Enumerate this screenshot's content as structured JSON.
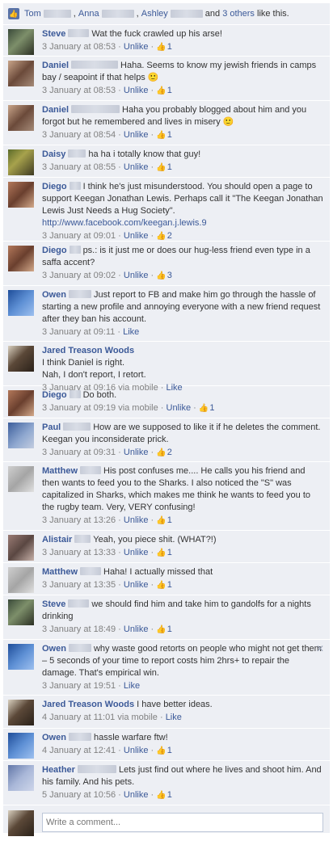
{
  "likes": {
    "names": [
      "Tom",
      "Anna",
      "Ashley"
    ],
    "and_text": "and",
    "others_link": "3 others",
    "suffix": "like this.",
    "thumb": "👍"
  },
  "labels": {
    "unlike": "Unlike",
    "like": "Like",
    "sep": " · "
  },
  "comments": [
    {
      "name": "Steve",
      "blur": 26,
      "text": "Wat the fuck crawled up his arse!",
      "time": "3 January at 08:53",
      "mobile": false,
      "action": "Unlike",
      "likes": "1",
      "avatar": "steve",
      "h": 39
    },
    {
      "name": "Daniel",
      "blur": 58,
      "text": "Haha. Seems to know my jewish friends in camps bay / seapoint if that helps 🙂",
      "time": "3 January at 08:53",
      "mobile": false,
      "action": "Unlike",
      "likes": "1",
      "avatar": "daniel",
      "h": 55
    },
    {
      "name": "Daniel",
      "blur": 60,
      "text": "Haha you probably blogged about him and you forgot but he remembered and lives in misery 🙂",
      "time": "3 January at 08:54",
      "mobile": false,
      "action": "Unlike",
      "likes": "1",
      "avatar": "daniel",
      "h": 55
    },
    {
      "name": "Daisy",
      "blur": 22,
      "text": "ha ha i totally know that guy!",
      "time": "3 January at 08:55",
      "mobile": false,
      "action": "Unlike",
      "likes": "1",
      "avatar": "daisy",
      "h": 40
    },
    {
      "name": "Diego",
      "blur": 14,
      "text": "I think he's just misunderstood. You should open a page to support Keegan Jonathan Lewis. Perhaps call it \"The Keegan Jonathan Lewis Just Needs a Hug Society\".",
      "link": "http://www.facebook.com/keegan.j.lewis.9",
      "time": "3 January at 09:01",
      "mobile": false,
      "action": "Unlike",
      "likes": "2",
      "avatar": "diego",
      "h": 79
    },
    {
      "name": "Diego",
      "blur": 14,
      "text": "ps.: is it just me or does our hug-less friend even type in a saffa accent?",
      "time": "3 January at 09:02",
      "mobile": false,
      "action": "Unlike",
      "likes": "3",
      "avatar": "diego",
      "h": 55
    },
    {
      "name": "Owen",
      "blur": 28,
      "text": "Just report to FB and make him go through the hassle of starting a new profile and annoying everyone with a new friend request after they ban his account.",
      "time": "3 January at 09:11",
      "mobile": false,
      "action": "Like",
      "likes": "",
      "avatar": "owen",
      "h": 69
    },
    {
      "name": "Jared Treason Woods",
      "blur": 0,
      "text": "I think Daniel is right.\nNah, I don't report, I retort.",
      "time": "3 January at 09:16",
      "mobile": true,
      "action": "Like",
      "likes": "",
      "avatar": "jared",
      "h": 55
    },
    {
      "name": "Diego",
      "blur": 14,
      "text": "Do both.",
      "time": "3 January at 09:19",
      "mobile": true,
      "action": "Unlike",
      "likes": "1",
      "avatar": "diego",
      "h": 40
    },
    {
      "name": "Paul",
      "blur": 34,
      "text": "How are we supposed to like it if he deletes the comment. Keegan you inconsiderate prick.",
      "time": "3 January at 09:31",
      "mobile": false,
      "action": "Unlike",
      "likes": "2",
      "avatar": "paul",
      "h": 54
    },
    {
      "name": "Matthew",
      "blur": 26,
      "text": "His post confuses me.... He calls you his friend and then wants to feed you to the Sharks. I also noticed the \"S\" was capitalized in Sharks, which makes me think he wants to feed you to the rugby team. Very, VERY confusing!",
      "time": "3 January at 13:26",
      "mobile": false,
      "action": "Unlike",
      "likes": "1",
      "avatar": "matthew",
      "h": 85
    },
    {
      "name": "Alistair",
      "blur": 20,
      "text": "Yeah, you piece shit. (WHAT?!)",
      "time": "3 January at 13:33",
      "mobile": false,
      "action": "Unlike",
      "likes": "1",
      "avatar": "alistair",
      "h": 40
    },
    {
      "name": "Matthew",
      "blur": 26,
      "text": "Haha! I actually missed that",
      "time": "3 January at 13:35",
      "mobile": false,
      "action": "Unlike",
      "likes": "1",
      "avatar": "matthew",
      "h": 40
    },
    {
      "name": "Steve",
      "blur": 26,
      "text": "we should find him and take him to gandolfs for a nights drinking",
      "time": "3 January at 18:49",
      "mobile": false,
      "action": "Unlike",
      "likes": "1",
      "avatar": "steve",
      "h": 55
    },
    {
      "name": "Owen",
      "blur": 28,
      "text": "why waste good retorts on people who might not get them – 5 seconds of your time to report costs him 2hrs+ to repair the damage. That's empirical win.",
      "time": "3 January at 19:51",
      "mobile": false,
      "action": "Like",
      "likes": "",
      "avatar": "owen",
      "h": 69,
      "close": "✕"
    },
    {
      "name": "Jared Treason Woods",
      "blur": 0,
      "text": "I have better ideas.",
      "time": "4 January at 11:01",
      "mobile": true,
      "action": "Like",
      "likes": "",
      "avatar": "jared",
      "h": 41
    },
    {
      "name": "Owen",
      "blur": 28,
      "text": "hassle warfare ftw!",
      "time": "4 January at 12:41",
      "mobile": false,
      "action": "Unlike",
      "likes": "1",
      "avatar": "owen",
      "h": 40
    },
    {
      "name": "Heather",
      "blur": 48,
      "text": "Lets just find out where he lives and shoot him. And his family. And his pets.",
      "time": "5 January at 10:56",
      "mobile": false,
      "action": "Unlike",
      "likes": "1",
      "avatar": "heather",
      "h": 55
    }
  ],
  "via_mobile": "via mobile",
  "composer": {
    "placeholder": "Write a comment..."
  }
}
